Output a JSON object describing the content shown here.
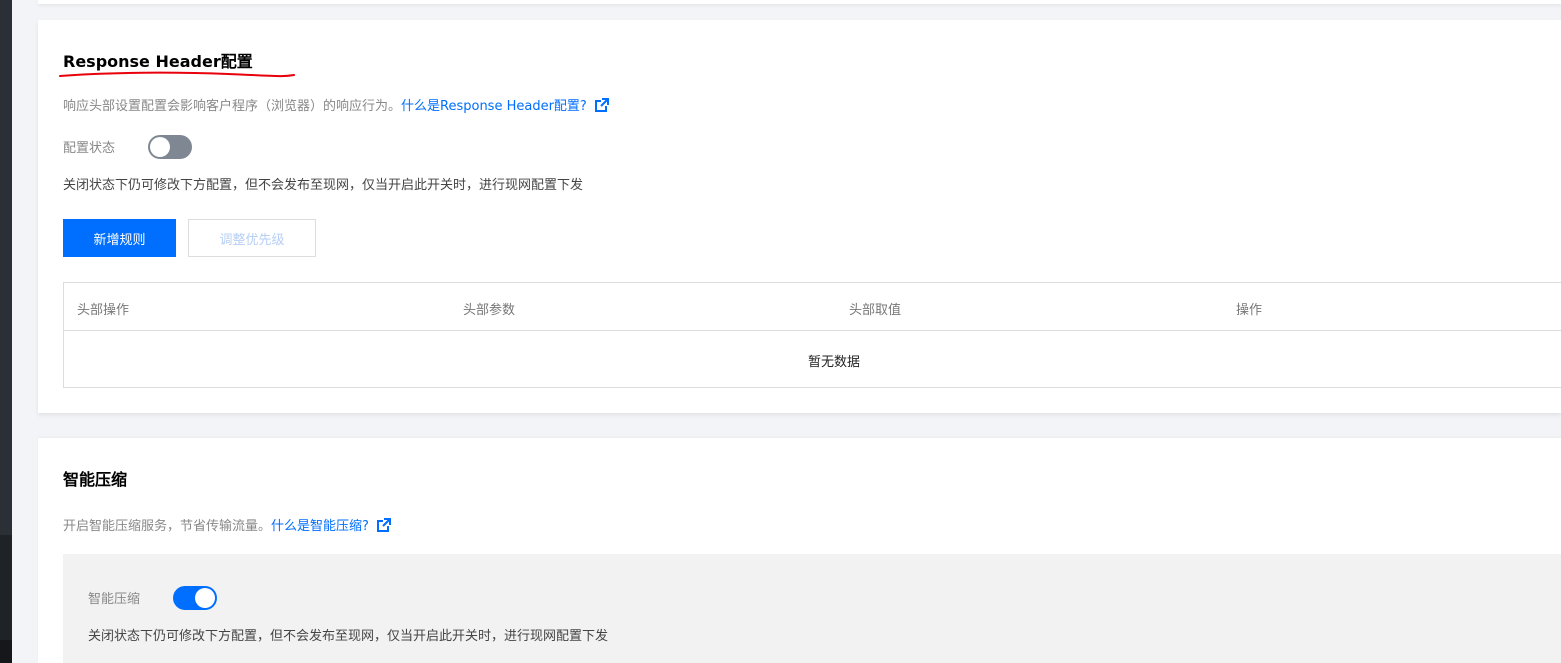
{
  "response_header": {
    "title": "Response Header配置",
    "description": "响应头部设置配置会影响客户程序（浏览器）的响应行为。",
    "help_link": "什么是Response Header配置?",
    "status_label": "配置状态",
    "status_on": false,
    "note": "关闭状态下仍可修改下方配置，但不会发布至现网，仅当开启此开关时，进行现网配置下发",
    "add_rule_label": "新增规则",
    "adjust_priority_label": "调整优先级",
    "table": {
      "columns": [
        "头部操作",
        "头部参数",
        "头部取值",
        "操作"
      ],
      "empty_text": "暂无数据"
    }
  },
  "smart_compression": {
    "title": "智能压缩",
    "description": "开启智能压缩服务，节省传输流量。",
    "help_link": "什么是智能压缩?",
    "toggle_label": "智能压缩",
    "toggle_on": true,
    "note": "关闭状态下仍可修改下方配置，但不会发布至现网，仅当开启此开关时，进行现网配置下发"
  },
  "colors": {
    "accent": "#006eff",
    "annotation_underline": "#e8000b"
  }
}
